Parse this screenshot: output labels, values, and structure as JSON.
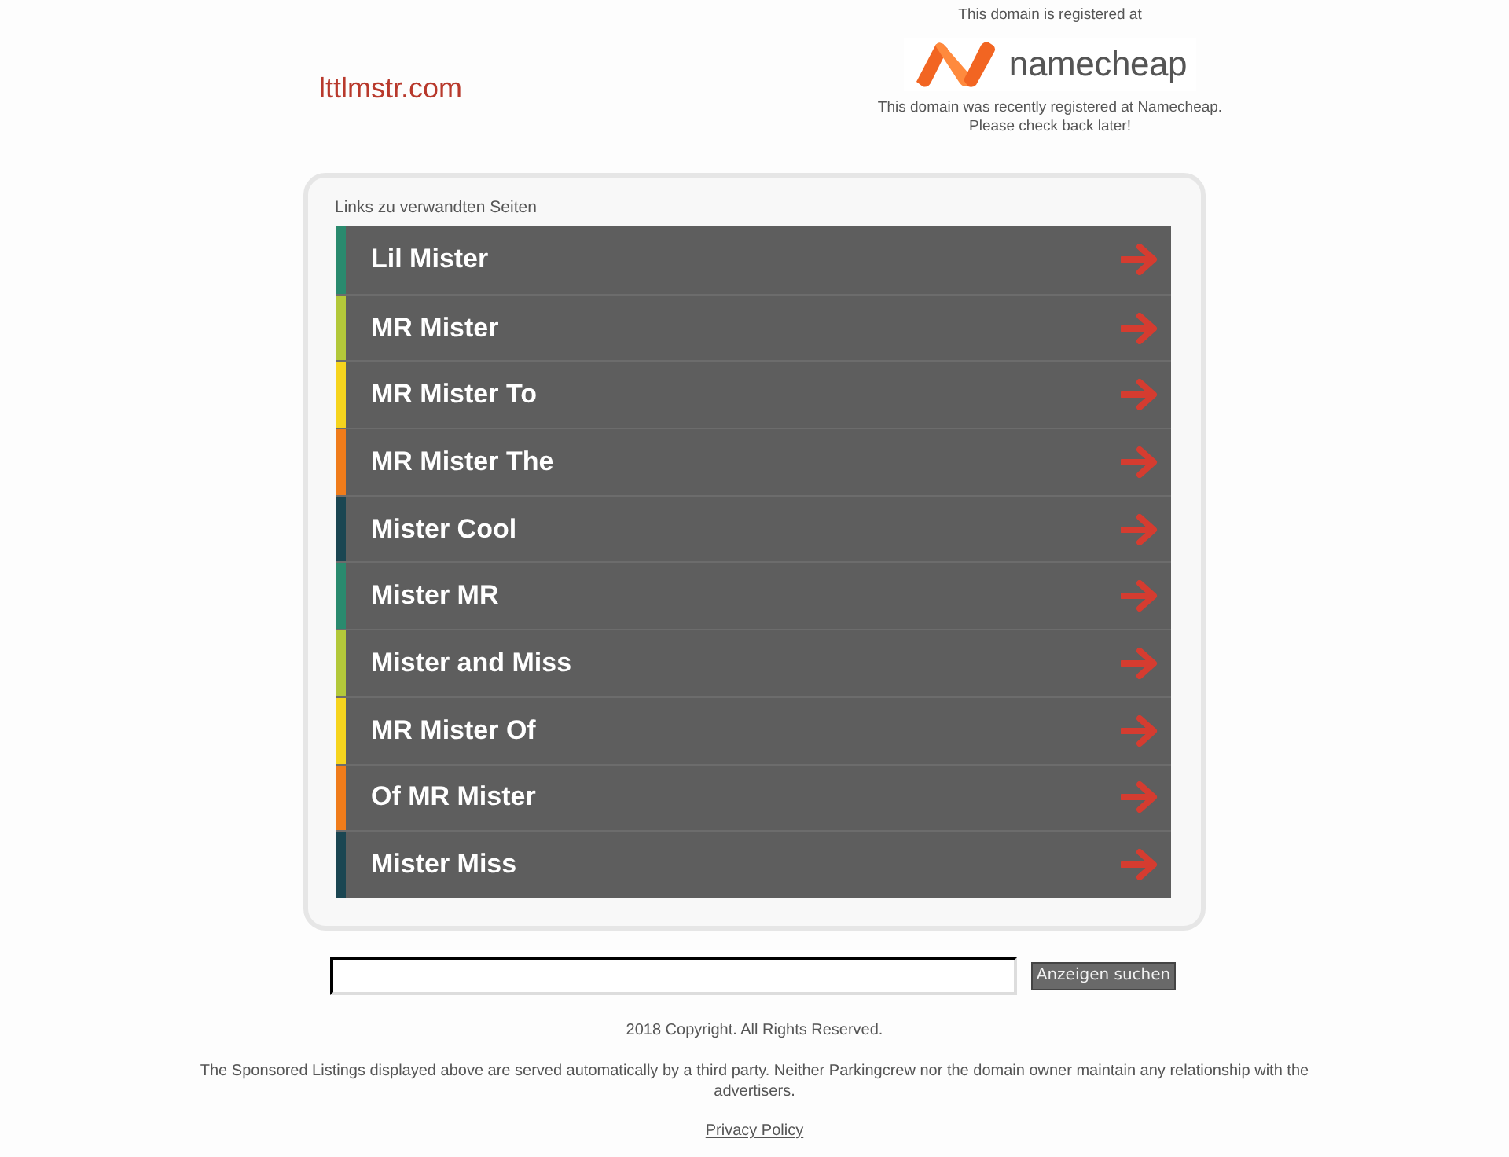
{
  "header": {
    "domain": "lttlmstr.com",
    "registrar_note": "This domain is registered at",
    "registrar_logo": {
      "text": "namecheap"
    },
    "registrar_message": [
      "This domain was recently registered at Namecheap.",
      "Please check back later!"
    ]
  },
  "related_links": {
    "heading": "Links zu verwandten Seiten",
    "items": [
      {
        "label": "Lil Mister",
        "color": "#2a8a6e"
      },
      {
        "label": "MR Mister",
        "color": "#b3c83a"
      },
      {
        "label": "MR Mister To",
        "color": "#f6d41e"
      },
      {
        "label": "MR Mister The",
        "color": "#f07c1b"
      },
      {
        "label": "Mister Cool",
        "color": "#1b4652"
      },
      {
        "label": "Mister MR",
        "color": "#2a8a6e"
      },
      {
        "label": "Mister and Miss",
        "color": "#b3c83a"
      },
      {
        "label": "MR Mister Of",
        "color": "#f6d41e"
      },
      {
        "label": "Of MR Mister",
        "color": "#f07c1b"
      },
      {
        "label": "Mister Miss",
        "color": "#1b4652"
      }
    ]
  },
  "search": {
    "button": "Anzeigen suchen"
  },
  "footer": {
    "copyright": "2018 Copyright. All Rights Reserved.",
    "disclaimer": "The Sponsored Listings displayed above are served automatically by a third party. Neither Parkingcrew nor the domain owner maintain any relationship with the advertisers.",
    "privacy_link": "Privacy Policy"
  }
}
